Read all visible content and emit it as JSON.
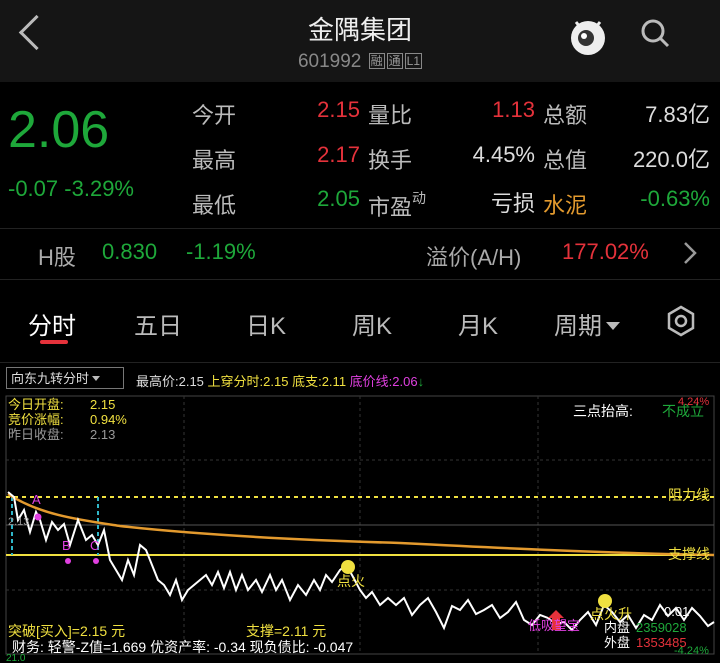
{
  "header": {
    "title": "金隅集团",
    "code": "601992",
    "tags": [
      "融",
      "通",
      "L1"
    ]
  },
  "quote": {
    "price": "2.06",
    "change": "-0.07",
    "change_pct": "-3.29%",
    "fields": [
      {
        "label": "今开",
        "value": "2.15"
      },
      {
        "label": "量比",
        "value": "1.13"
      },
      {
        "label": "总额",
        "value": "7.83亿"
      },
      {
        "label": "最高",
        "value": "2.17"
      },
      {
        "label": "换手",
        "value": "4.45%"
      },
      {
        "label": "总值",
        "value": "220.0亿"
      },
      {
        "label": "最低",
        "value": "2.05"
      },
      {
        "label": "市盈",
        "label_sup": "动",
        "value": "亏损"
      },
      {
        "label": "水泥",
        "value": "-0.63%"
      }
    ]
  },
  "hshare": {
    "label": "H股",
    "price": "0.830",
    "change_pct": "-1.19%",
    "premium_label": "溢价(A/H)",
    "premium": "177.02%"
  },
  "tabs": [
    "分时",
    "五日",
    "日K",
    "周K",
    "月K",
    "周期"
  ],
  "toolbar": {
    "dropdown": "向东九转分时",
    "items": [
      {
        "text": "最高价:2.15",
        "color": "#dddddd"
      },
      {
        "text": "上穿分时:2.15",
        "color": "#f0e040"
      },
      {
        "text": "底支:2.11",
        "color": "#f0e040"
      },
      {
        "text": "底价线:2.06",
        "color": "#e040e0"
      },
      {
        "text": "↓",
        "color": "#1ea83a"
      }
    ]
  },
  "chart_info": {
    "open_label": "今日开盘:",
    "open": "2.15",
    "bid_label": "竞价涨幅:",
    "bid": "0.94%",
    "prev_label": "昨日收盘:",
    "prev": "2.13",
    "three_points": "三点抬高:",
    "three_points_val": "不成立",
    "top_pct": "4.24%",
    "bottom_pct": "-4.24%",
    "price_tick": "2.13",
    "resistance": "阻力线",
    "support": "支撑线",
    "marker_a": "A",
    "marker_b": "B",
    "marker_c": "C",
    "dian_a": "点火",
    "dian_b": "点火升",
    "signal_mid": "低吸望宝",
    "breakout": "突破[买入]=2.15 元",
    "support_val": "支撑=2.11 元",
    "finance": "财务: 轻警-Z值=1.669 优资产率: -0.34 现负债比: -0.047",
    "inner_label": "内盘",
    "inner": "2359028",
    "outer_label": "外盘",
    "outer": "1353485",
    "left_bottom": "21.0",
    "right_num": "0.01"
  },
  "colors": {
    "up": "#e5323b",
    "down": "#1ea83a",
    "accent": "#f0e040",
    "avg": "#e39a2e"
  }
}
